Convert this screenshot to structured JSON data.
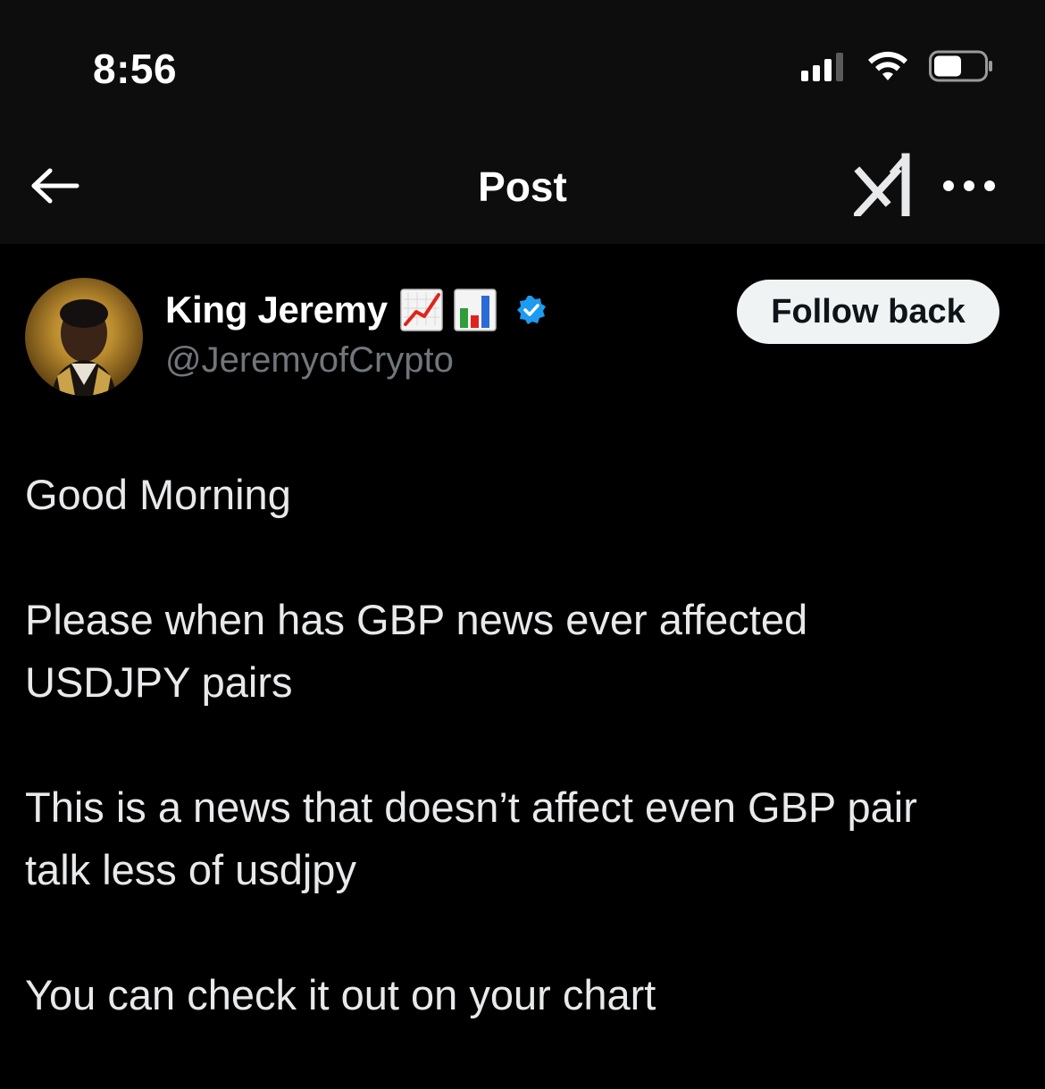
{
  "status_bar": {
    "time": "8:56",
    "signal_icon": "cellular-signal-icon",
    "wifi_icon": "wifi-icon",
    "battery_icon": "battery-icon"
  },
  "nav": {
    "back_icon": "arrow-left-icon",
    "title": "Post",
    "grok_icon": "grok-icon",
    "more_icon": "more-horizontal-icon"
  },
  "post": {
    "author": {
      "name": "King Jeremy",
      "name_emojis": [
        "chart-increasing-emoji",
        "bar-chart-emoji"
      ],
      "verified": true,
      "handle": "@JeremyofCrypto"
    },
    "follow_button_label": "Follow back",
    "paragraphs": [
      [
        "Good Morning"
      ],
      [
        "Please when has GBP news ever affected",
        "USDJPY pairs"
      ],
      [
        "This is a news that doesn’t affect even GBP pair",
        "talk less of usdjpy"
      ],
      [
        "You can check it out on your chart"
      ]
    ]
  },
  "colors": {
    "background": "#000000",
    "header_background": "#0d0d0d",
    "text_primary": "#e7e9ea",
    "text_secondary": "#71767b",
    "verified_blue": "#1d9bf0",
    "follow_button_bg": "#eff3f4"
  }
}
